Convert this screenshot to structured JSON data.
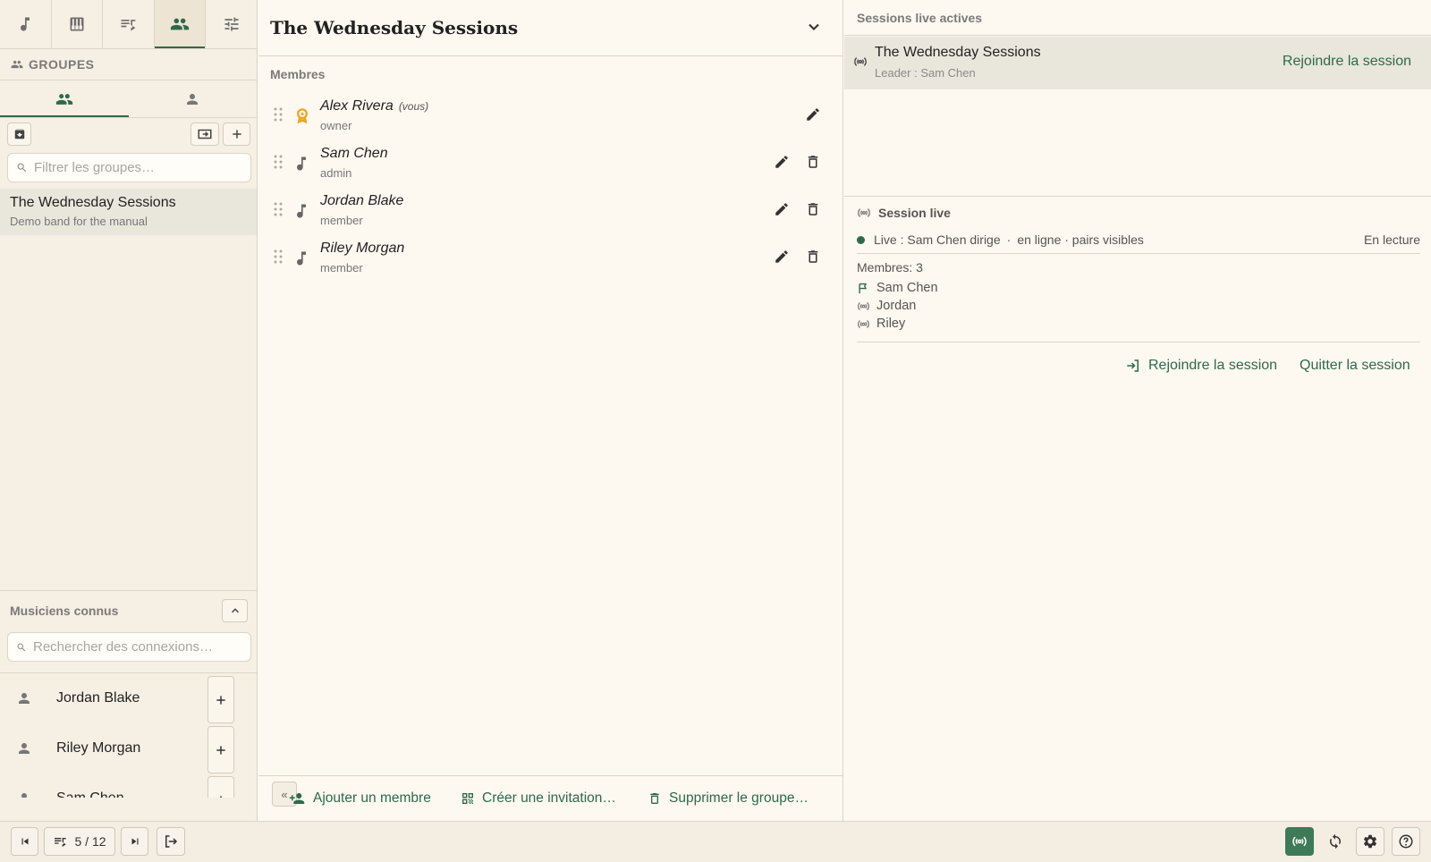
{
  "colors": {
    "accent": "#2e6a4a",
    "background": "#fdf8f0",
    "selected_row": "#e9e6dc",
    "owner_badge": "#e8a72a"
  },
  "left": {
    "top_tabs": [
      "music-note-icon",
      "piano-icon",
      "playlist-icon",
      "groups-icon",
      "sliders-icon"
    ],
    "active_tab": "groups-icon",
    "section_title": "GROUPES",
    "filter_placeholder": "Filtrer les groupes…",
    "groups": [
      {
        "name": "The Wednesday Sessions",
        "description": "Demo band for the manual"
      }
    ],
    "known_title": "Musiciens connus",
    "connections_placeholder": "Rechercher des connexions…",
    "connections": [
      {
        "name": "Jordan Blake"
      },
      {
        "name": "Riley Morgan"
      },
      {
        "name": "Sam Chen"
      }
    ]
  },
  "middle": {
    "title": "The Wednesday Sessions",
    "members_label": "Membres",
    "members": [
      {
        "name": "Alex Rivera",
        "you": "(vous)",
        "role": "owner"
      },
      {
        "name": "Sam Chen",
        "role": "admin"
      },
      {
        "name": "Jordan Blake",
        "role": "member"
      },
      {
        "name": "Riley Morgan",
        "role": "member"
      }
    ],
    "footer": {
      "add_member": "Ajouter un membre",
      "create_invite": "Créer une invitation…",
      "delete_group": "Supprimer le groupe…"
    }
  },
  "right": {
    "live_title": "Sessions live actives",
    "live_session": {
      "name": "The Wednesday Sessions",
      "leader": "Leader : Sam Chen",
      "join": "Rejoindre la session"
    },
    "session_card": {
      "title": "Session live",
      "line_live": "Live : Sam Chen dirige",
      "line_sep": "·",
      "line_state": "en ligne · pairs visibles",
      "status": "En lecture",
      "members_count": "Membres: 3",
      "members": [
        {
          "name": "Sam Chen",
          "icon": "flag-icon"
        },
        {
          "name": "Jordan",
          "icon": "broadcast-icon"
        },
        {
          "name": "Riley",
          "icon": "broadcast-icon"
        }
      ],
      "join": "Rejoindre la session",
      "quit": "Quitter la session"
    }
  },
  "bottom": {
    "page_counter": "5 / 12"
  }
}
